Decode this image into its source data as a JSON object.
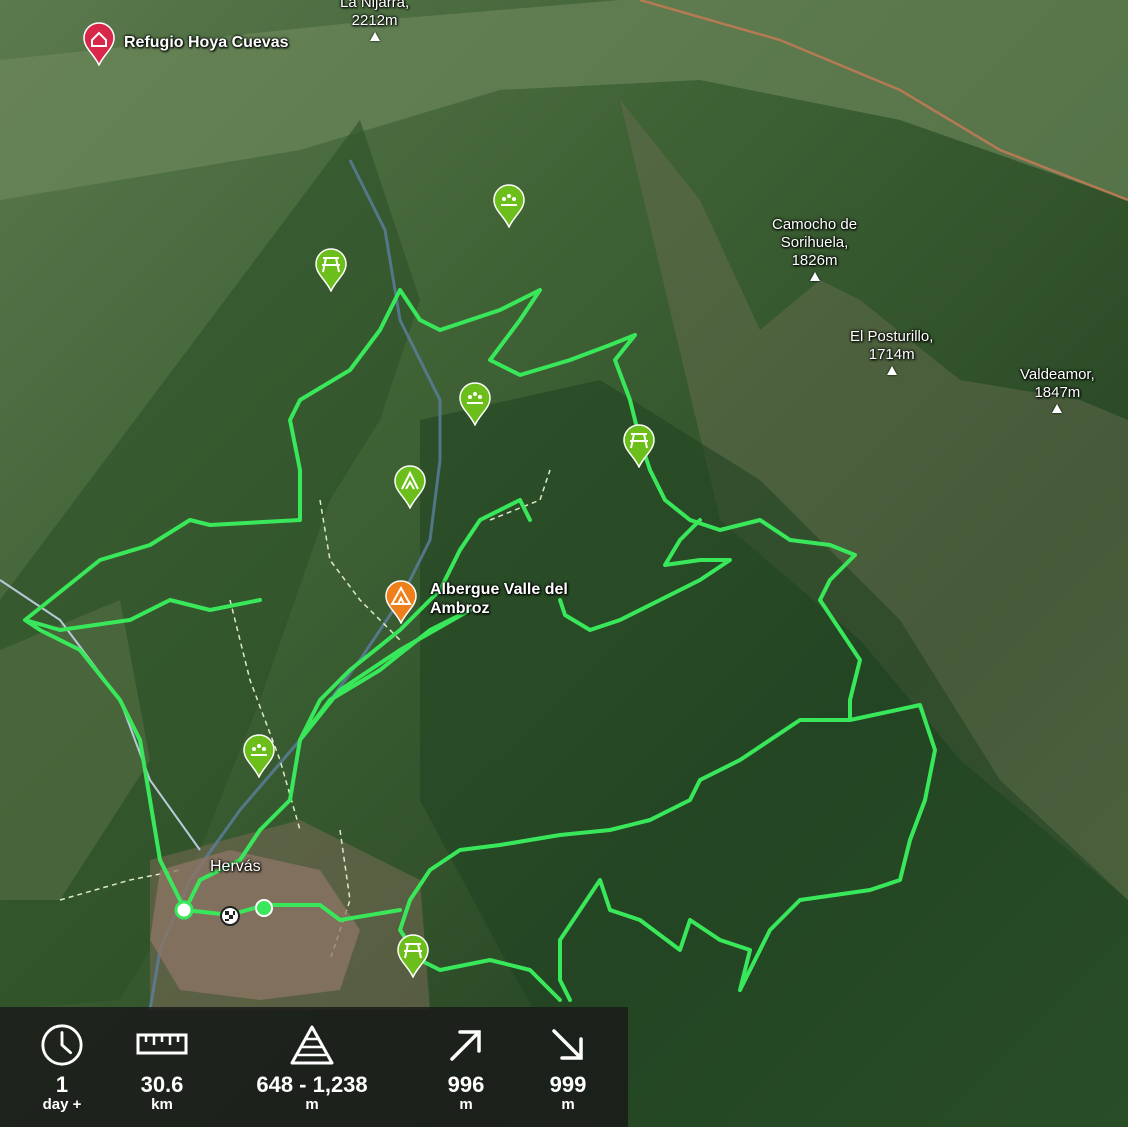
{
  "map": {
    "peaks": [
      {
        "name": "La Nijarra,",
        "elev": "2212m"
      },
      {
        "name": "Camocho de\nSorihuela,",
        "elev": "1826m"
      },
      {
        "name": "El Posturillo,",
        "elev": "1714m"
      },
      {
        "name": "Valdeamor,",
        "elev": "1847m"
      }
    ],
    "places": {
      "refugio": "Refugio Hoya Cuevas",
      "albergue": "Albergue Valle del\nAmbroz",
      "town": "Hervás"
    },
    "pins": [
      {
        "icon": "refuge-pin-icon",
        "color": "#d8284a"
      },
      {
        "icon": "picnic-pin-icon",
        "color": "#6cbf1a"
      },
      {
        "icon": "viewpoint-pin-icon",
        "color": "#6cbf1a"
      },
      {
        "icon": "campsite-pin-icon",
        "color": "#ef7f1a"
      }
    ],
    "route_color": "#39e85a"
  },
  "stats": {
    "duration": {
      "value": "1",
      "unit": "day +",
      "icon": "clock-icon"
    },
    "distance": {
      "value": "30.6",
      "unit": "km",
      "icon": "ruler-icon"
    },
    "altitude": {
      "value": "648 - 1,238",
      "unit": "m",
      "icon": "altitude-icon"
    },
    "ascent": {
      "value": "996",
      "unit": "m",
      "icon": "ascent-arrow-icon"
    },
    "descent": {
      "value": "999",
      "unit": "m",
      "icon": "descent-arrow-icon"
    }
  }
}
